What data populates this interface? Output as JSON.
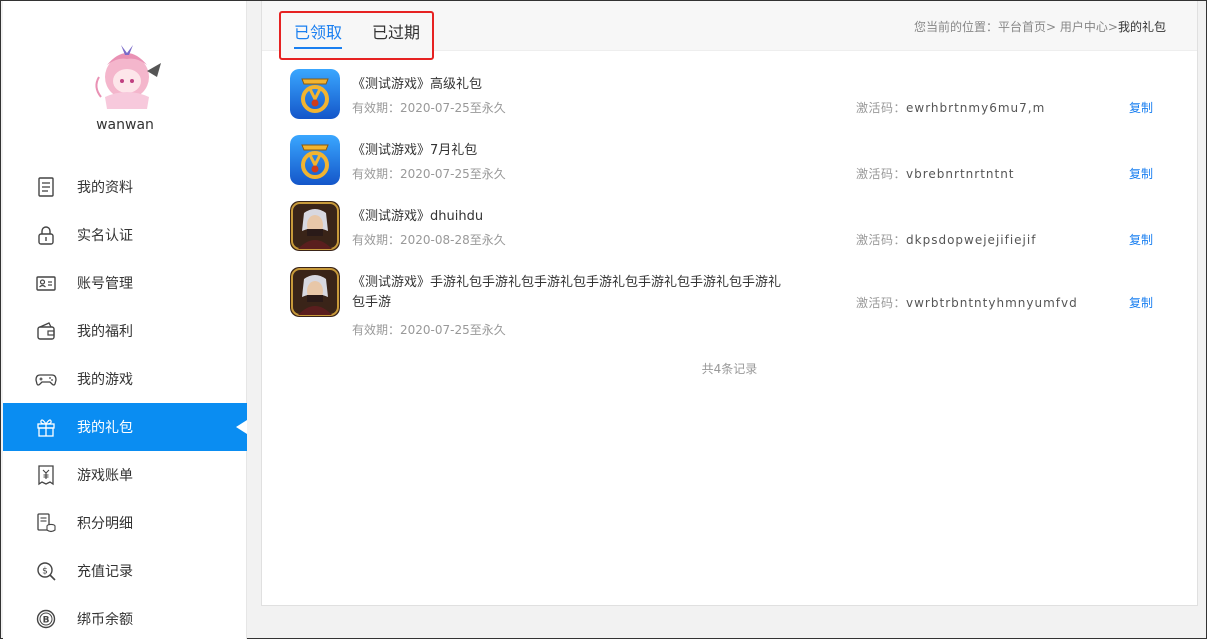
{
  "user": {
    "name": "wanwan"
  },
  "sidebar": {
    "items": [
      {
        "label": "我的资料",
        "icon": "document-icon",
        "active": false
      },
      {
        "label": "实名认证",
        "icon": "lock-icon",
        "active": false
      },
      {
        "label": "账号管理",
        "icon": "id-card-icon",
        "active": false
      },
      {
        "label": "我的福利",
        "icon": "wallet-icon",
        "active": false
      },
      {
        "label": "我的游戏",
        "icon": "gamepad-icon",
        "active": false
      },
      {
        "label": "我的礼包",
        "icon": "gift-icon",
        "active": true
      },
      {
        "label": "游戏账单",
        "icon": "bill-icon",
        "active": false
      },
      {
        "label": "积分明细",
        "icon": "points-icon",
        "active": false
      },
      {
        "label": "充值记录",
        "icon": "dollar-search-icon",
        "active": false
      },
      {
        "label": "绑币余额",
        "icon": "coin-b-icon",
        "active": false
      }
    ]
  },
  "tabs": [
    {
      "label": "已领取",
      "active": true
    },
    {
      "label": "已过期",
      "active": false
    }
  ],
  "breadcrumb": {
    "prefix": "您当前的位置：",
    "home": "平台首页",
    "sep1": "> ",
    "center": "用户中心",
    "sep2": ">",
    "current": "我的礼包"
  },
  "gifts": [
    {
      "title": "《测试游戏》高级礼包",
      "validity": "有效期：2020-07-25至永久",
      "code_label": "激活码：",
      "code": "ewrhbrtnmy6mu7,m",
      "copy": "复制",
      "icon": "game-icon-gold"
    },
    {
      "title": "《测试游戏》7月礼包",
      "validity": "有效期：2020-07-25至永久",
      "code_label": "激活码：",
      "code": "vbrebnrtnrtntnt",
      "copy": "复制",
      "icon": "game-icon-gold"
    },
    {
      "title": "《测试游戏》dhuihdu",
      "validity": "有效期：2020-08-28至永久",
      "code_label": "激活码：",
      "code": "dkpsdopwejejifiejif",
      "copy": "复制",
      "icon": "game-icon-warrior"
    },
    {
      "title": "《测试游戏》手游礼包手游礼包手游礼包手游礼包手游礼包手游礼包手游礼包手游",
      "validity": "有效期：2020-07-25至永久",
      "code_label": "激活码：",
      "code": "vwrbtrbntntyhmnyumfvd",
      "copy": "复制",
      "icon": "game-icon-warrior"
    }
  ],
  "total_text": "共4条记录",
  "colors": {
    "accent": "#0a8df2",
    "link": "#1a7ff0",
    "highlight_border": "#e62222"
  }
}
